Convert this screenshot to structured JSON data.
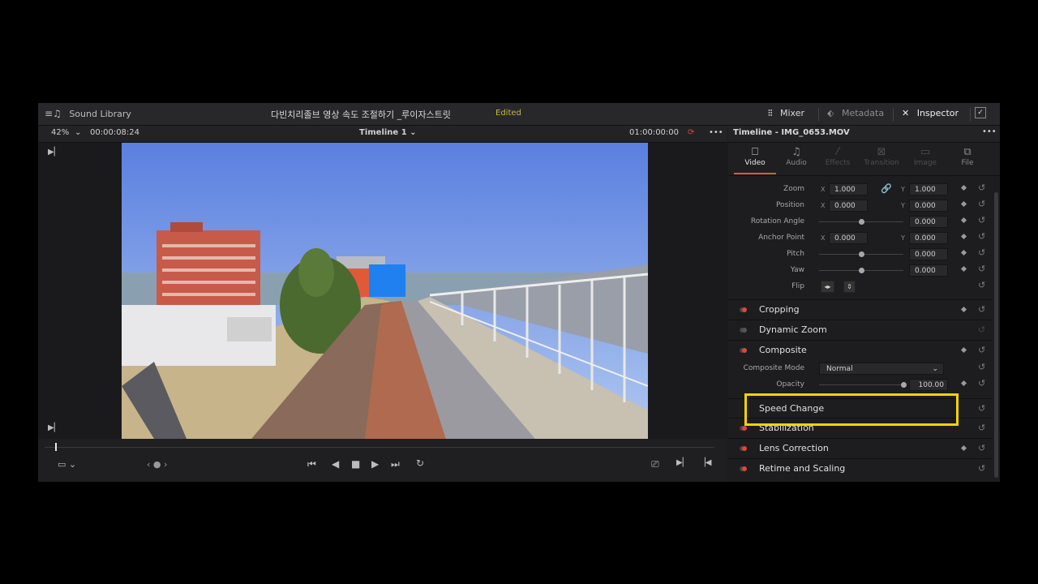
{
  "topbar": {
    "sound_library": "Sound Library",
    "project_title": "다빈치리졸브 영상 속도 조절하기 _루이자스트릿",
    "edited": "Edited",
    "mixer": "Mixer",
    "metadata": "Metadata",
    "inspector": "Inspector"
  },
  "viewer": {
    "zoom": "42%",
    "timecode_left": "00:00:08:24",
    "timeline_name": "Timeline 1",
    "timecode_right": "01:00:00:00"
  },
  "inspector": {
    "header": "Timeline - IMG_0653.MOV",
    "tabs": [
      "Video",
      "Audio",
      "Effects",
      "Transition",
      "Image",
      "File"
    ],
    "transform": {
      "zoom_label": "Zoom",
      "zoom_x": "1.000",
      "zoom_y": "1.000",
      "position_label": "Position",
      "position_x": "0.000",
      "position_y": "0.000",
      "rotation_label": "Rotation Angle",
      "rotation": "0.000",
      "anchor_label": "Anchor Point",
      "anchor_x": "0.000",
      "anchor_y": "0.000",
      "pitch_label": "Pitch",
      "pitch": "0.000",
      "yaw_label": "Yaw",
      "yaw": "0.000",
      "flip_label": "Flip",
      "axis_x": "X",
      "axis_y": "Y"
    },
    "sections": {
      "cropping": "Cropping",
      "dynamic_zoom": "Dynamic Zoom",
      "composite": "Composite",
      "composite_mode_label": "Composite Mode",
      "composite_mode_value": "Normal",
      "opacity_label": "Opacity",
      "opacity_value": "100.00",
      "speed_change": "Speed Change",
      "stabilization": "Stabilization",
      "lens_correction": "Lens Correction",
      "retime_scaling": "Retime and Scaling"
    }
  },
  "colors": {
    "accent": "#e0473a",
    "highlight": "#f2d400",
    "edited": "#c9b54a"
  },
  "playhead_fraction": 0.0
}
